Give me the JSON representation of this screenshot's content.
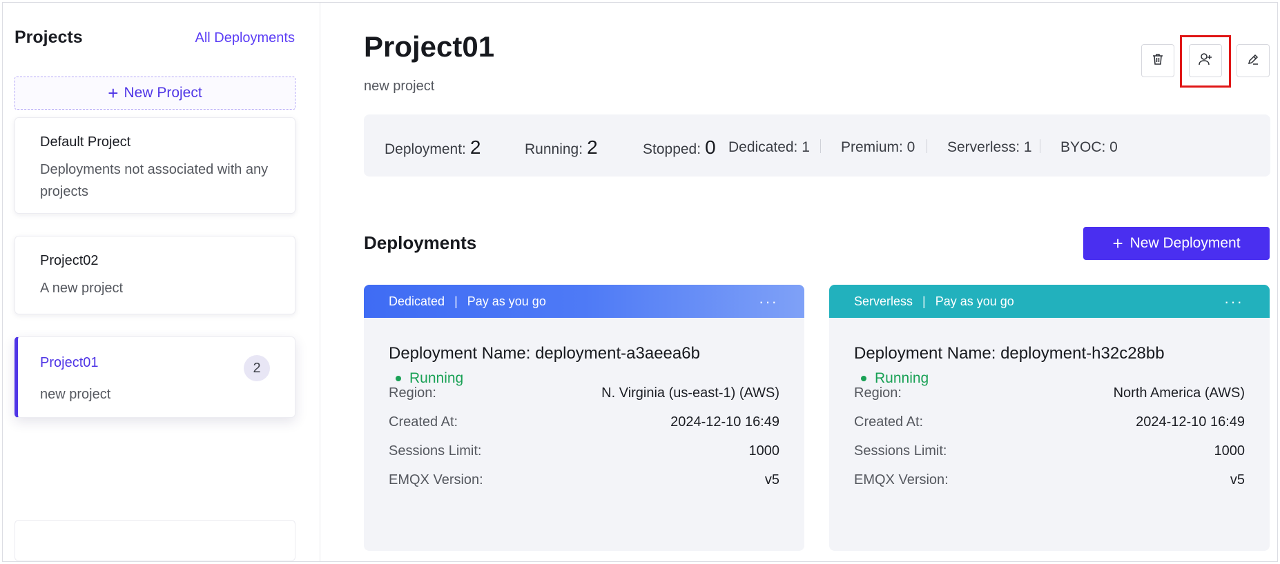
{
  "sidebar": {
    "title": "Projects",
    "all_link": "All Deployments",
    "new_project": "New Project",
    "projects": [
      {
        "name": "Default Project",
        "desc": "Deployments not associated with any projects"
      },
      {
        "name": "Project02",
        "desc": "A new project"
      },
      {
        "name": "Project01",
        "desc": "new project",
        "count": "2"
      }
    ]
  },
  "header": {
    "title": "Project01",
    "subtitle": "new project",
    "actions": {
      "delete": "trash-icon",
      "invite": "user-add-icon",
      "edit": "pencil-icon"
    }
  },
  "stats": {
    "deployment_label": "Deployment:",
    "deployment_value": "2",
    "running_label": "Running:",
    "running_value": "2",
    "stopped_label": "Stopped:",
    "stopped_value": "0",
    "dedicated": "Dedicated: 1",
    "premium": "Premium: 0",
    "serverless": "Serverless: 1",
    "byoc": "BYOC: 0"
  },
  "deployments": {
    "title": "Deployments",
    "new_button": "New Deployment",
    "cards": [
      {
        "type": "Dedicated",
        "billing": "Pay as you go",
        "name": "Deployment Name: deployment-a3aeea6b",
        "status": "Running",
        "rows": [
          {
            "k": "Region:",
            "v": "N. Virginia (us-east-1) (AWS)"
          },
          {
            "k": "Created At:",
            "v": "2024-12-10 16:49"
          },
          {
            "k": "Sessions Limit:",
            "v": "1000"
          },
          {
            "k": "EMQX Version:",
            "v": "v5"
          }
        ]
      },
      {
        "type": "Serverless",
        "billing": "Pay as you go",
        "name": "Deployment Name: deployment-h32c28bb",
        "status": "Running",
        "rows": [
          {
            "k": "Region:",
            "v": "North America (AWS)"
          },
          {
            "k": "Created At:",
            "v": "2024-12-10 16:49"
          },
          {
            "k": "Sessions Limit:",
            "v": "1000"
          },
          {
            "k": "EMQX Version:",
            "v": "v5"
          }
        ]
      }
    ]
  },
  "colors": {
    "accent": "#4a2ff0",
    "running": "#1aa156",
    "highlight": "#e01616"
  }
}
